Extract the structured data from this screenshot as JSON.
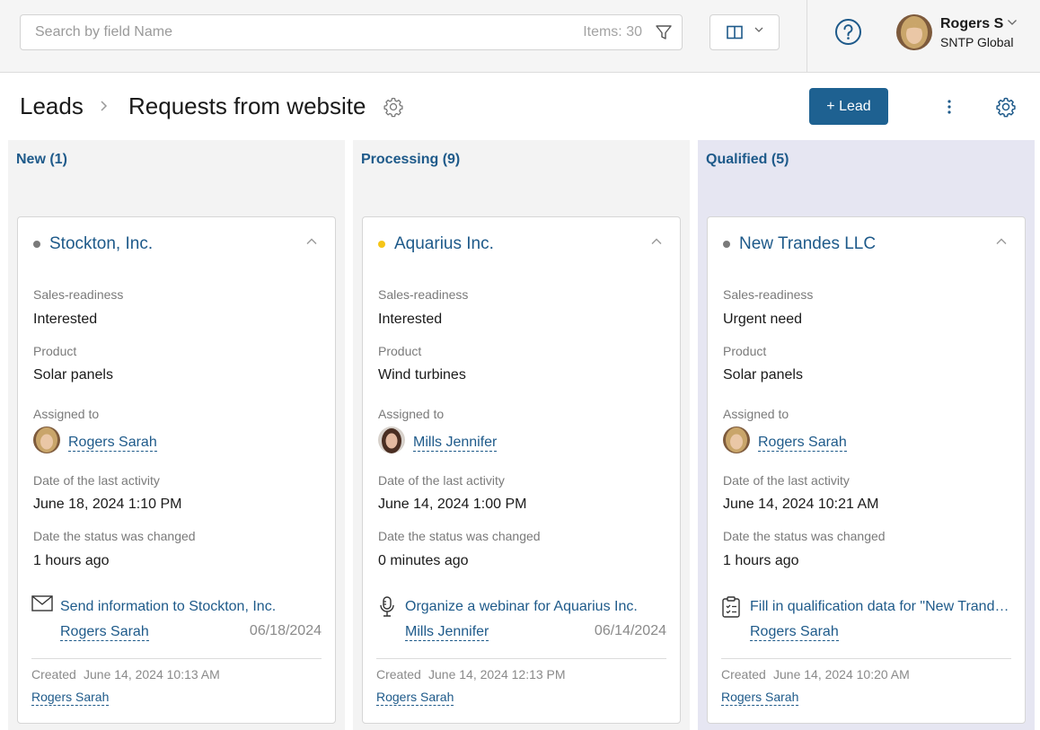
{
  "search": {
    "placeholder": "Search by field Name",
    "items_count": "Items: 30"
  },
  "user": {
    "name": "Rogers S",
    "org": "SNTP Global"
  },
  "breadcrumb": {
    "root": "Leads",
    "current": "Requests from website"
  },
  "actions": {
    "add_lead": "+ Lead"
  },
  "colors": {
    "accent": "#1e6191",
    "link": "#1e5a8a",
    "dot_gray": "#7a7a7a",
    "dot_yellow": "#f5c518",
    "qualified_bg": "#e6e6f2"
  },
  "columns": [
    {
      "title": "New (1)",
      "card": {
        "company": "Stockton, Inc.",
        "status_dot": "gray",
        "sales_readiness_label": "Sales-readiness",
        "sales_readiness": "Interested",
        "product_label": "Product",
        "product": "Solar panels",
        "assigned_label": "Assigned to",
        "assignee": "Rogers Sarah",
        "last_activity_label": "Date of the last activity",
        "last_activity": "June 18, 2024 1:10 PM",
        "status_changed_label": "Date the status was changed",
        "status_changed": "1 hours ago",
        "task_icon": "envelope-icon",
        "task_title": "Send information to Stockton, Inc.",
        "task_user": "Rogers Sarah",
        "task_date": "06/18/2024",
        "created_label": "Created",
        "created": "June 14, 2024 10:13 AM",
        "creator": "Rogers Sarah"
      }
    },
    {
      "title": "Processing (9)",
      "card": {
        "company": "Aquarius Inc.",
        "status_dot": "yellow",
        "sales_readiness_label": "Sales-readiness",
        "sales_readiness": "Interested",
        "product_label": "Product",
        "product": "Wind turbines",
        "assigned_label": "Assigned to",
        "assignee": "Mills Jennifer",
        "last_activity_label": "Date of the last activity",
        "last_activity": "June 14, 2024 1:00 PM",
        "status_changed_label": "Date the status was changed",
        "status_changed": "0 minutes ago",
        "task_icon": "microphone-icon",
        "task_title": "Organize a webinar for Aquarius Inc.",
        "task_user": "Mills Jennifer",
        "task_date": "06/14/2024",
        "created_label": "Created",
        "created": "June 14, 2024 12:13 PM",
        "creator": "Rogers Sarah"
      }
    },
    {
      "title": "Qualified (5)",
      "card": {
        "company": "New Trandes LLC",
        "status_dot": "gray",
        "sales_readiness_label": "Sales-readiness",
        "sales_readiness": "Urgent need",
        "product_label": "Product",
        "product": "Solar panels",
        "assigned_label": "Assigned to",
        "assignee": "Rogers Sarah",
        "last_activity_label": "Date of the last activity",
        "last_activity": "June 14, 2024 10:21 AM",
        "status_changed_label": "Date the status was changed",
        "status_changed": "1 hours ago",
        "task_icon": "clipboard-checklist-icon",
        "task_title": "Fill in qualification data for \"New Trandes LLC\"",
        "task_user": "Rogers Sarah",
        "task_date": "",
        "created_label": "Created",
        "created": "June 14, 2024 10:20 AM",
        "creator": "Rogers Sarah"
      }
    }
  ]
}
